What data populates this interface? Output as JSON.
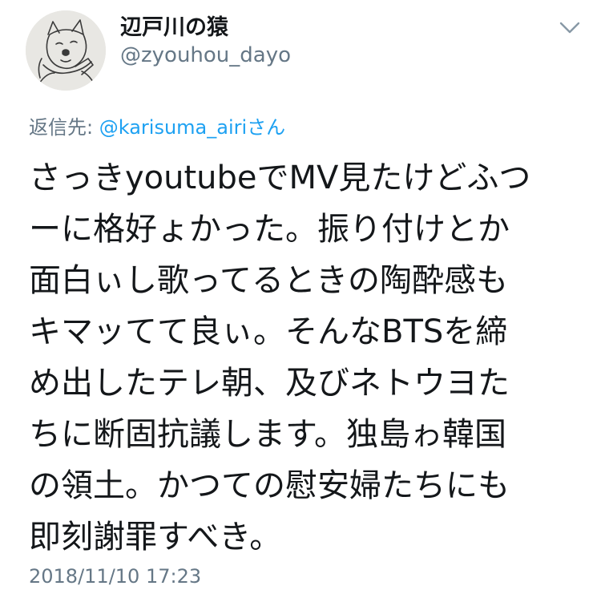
{
  "tweet": {
    "display_name": "辺戸川の猿",
    "handle": "@zyouhou_dayo",
    "reply_prefix": "返信先: ",
    "reply_to": "@karisuma_airiさん",
    "text": "さっきyoutubeでMV見たけどふつ\nーに格好ょかった。振り付けとか\n面白ぃし歌ってるときの陶酔感も\nキマッてて良ぃ。そんなBTSを締\nめ出したテレ朝、及びネトウヨた\nちに断固抗議します。独島ゎ韓国\nの領土。かつての慰安婦たちにも\n即刻謝罪すべき。",
    "timestamp": "2018/11/10 17:23"
  },
  "icons": {
    "avatar": "dog-sketch-avatar",
    "menu": "chevron-down-icon"
  },
  "colors": {
    "name": "#14171a",
    "secondary": "#657786",
    "link": "#1da1f2",
    "background": "#ffffff"
  }
}
